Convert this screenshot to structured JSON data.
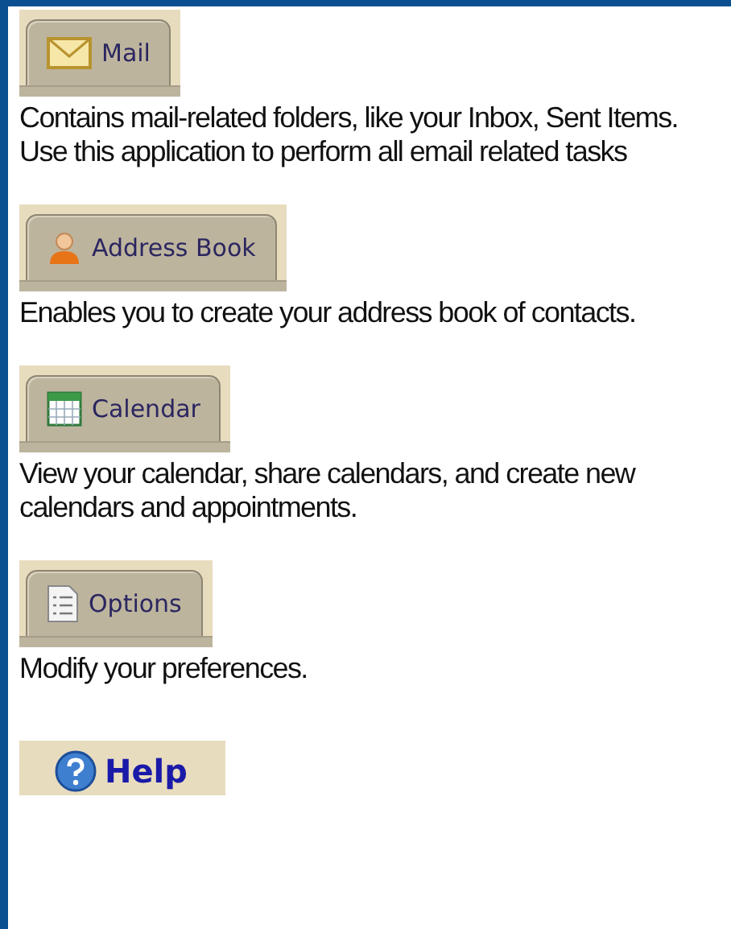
{
  "sections": [
    {
      "kind": "tab",
      "label": "Mail",
      "description": "Contains mail-related folders, like your Inbox, Sent Items. Use this application to perform all email related tasks"
    },
    {
      "kind": "tab",
      "label": "Address Book",
      "description": "Enables you to create your address book of contacts."
    },
    {
      "kind": "tab",
      "label": "Calendar",
      "description": "View your calendar, share calendars, and create new calendars and appointments."
    },
    {
      "kind": "tab",
      "label": "Options",
      "description": "Modify your preferences."
    },
    {
      "kind": "help",
      "label": "Help"
    }
  ]
}
